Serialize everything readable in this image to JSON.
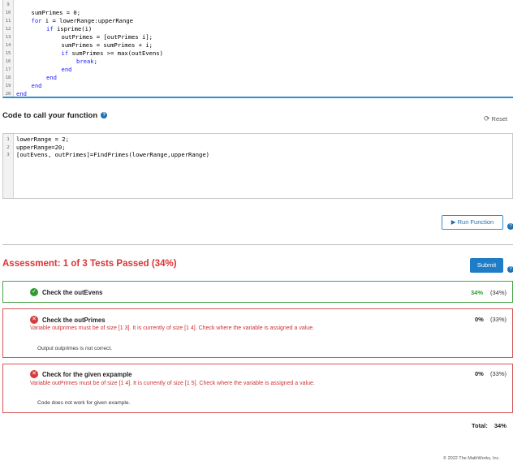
{
  "solution_editor": {
    "lines": [
      {
        "num": "9",
        "indent": 0,
        "parts": [
          {
            "t": ""
          }
        ]
      },
      {
        "num": "10",
        "indent": 1,
        "parts": [
          {
            "t": "sumPrimes = 0;"
          }
        ]
      },
      {
        "num": "11",
        "indent": 1,
        "parts": [
          {
            "t": "for",
            "k": true
          },
          {
            "t": " i = lowerRange:upperRange"
          }
        ]
      },
      {
        "num": "12",
        "indent": 2,
        "parts": [
          {
            "t": "if",
            "k": true
          },
          {
            "t": " isprime(i)"
          }
        ]
      },
      {
        "num": "13",
        "indent": 3,
        "parts": [
          {
            "t": "outPrimes = [outPrimes i];"
          }
        ]
      },
      {
        "num": "14",
        "indent": 3,
        "parts": [
          {
            "t": "sumPrimes = sumPrimes + i;"
          }
        ]
      },
      {
        "num": "15",
        "indent": 3,
        "parts": [
          {
            "t": "if",
            "k": true
          },
          {
            "t": " sumPrimes >= max(outEvens)"
          }
        ]
      },
      {
        "num": "16",
        "indent": 4,
        "parts": [
          {
            "t": "break",
            "k": true
          },
          {
            "t": ";"
          }
        ]
      },
      {
        "num": "17",
        "indent": 3,
        "parts": [
          {
            "t": "end",
            "k": true
          }
        ]
      },
      {
        "num": "18",
        "indent": 2,
        "parts": [
          {
            "t": "end",
            "k": true
          }
        ]
      },
      {
        "num": "19",
        "indent": 1,
        "parts": [
          {
            "t": "end",
            "k": true
          }
        ]
      },
      {
        "num": "20",
        "indent": 0,
        "parts": [
          {
            "t": "end",
            "k": true
          }
        ]
      }
    ]
  },
  "call_section": {
    "heading": "Code to call your function",
    "help_glyph": "?",
    "reset_label": "Reset",
    "reset_glyph": "⟳",
    "lines": [
      {
        "num": "1",
        "text": "lowerRange = 2;"
      },
      {
        "num": "2",
        "text": "upperRange=20;"
      },
      {
        "num": "3",
        "text": "[outEvens, outPrimes]=FindPrimes(lowerRange,upperRange)"
      }
    ],
    "run_label": "Run Function",
    "run_glyph": "▶"
  },
  "assessment": {
    "heading": "Assessment: 1 of 3 Tests Passed (34%)",
    "submit_label": "Submit",
    "tests": [
      {
        "status": "pass",
        "title": "Check the outEvens",
        "percent": "34%",
        "weight": "(34%)",
        "error": "",
        "message": ""
      },
      {
        "status": "fail",
        "title": "Check the outPrimes",
        "percent": "0%",
        "weight": "(33%)",
        "error": "Variable outprimes must be of size [1 3]. It is currently of size [1 4]. Check where the variable is assigned a value.",
        "message": "Output outprimes is not correct."
      },
      {
        "status": "fail",
        "title": "Check for the given expample",
        "percent": "0%",
        "weight": "(33%)",
        "error": "Variable outPrimes must be of size [1 4]. It is currently of size [1 5]. Check where the variable is assigned a value.",
        "message": "Code does not work for given example."
      }
    ],
    "total_label": "Total:",
    "total_value": "34%"
  },
  "footer": {
    "copyright": "© 2022 The MathWorks, Inc."
  },
  "colors": {
    "accent": "#1f7cc7",
    "pass": "#2e9d2e",
    "fail": "#d83a3a",
    "keyword": "#1a1aff"
  }
}
